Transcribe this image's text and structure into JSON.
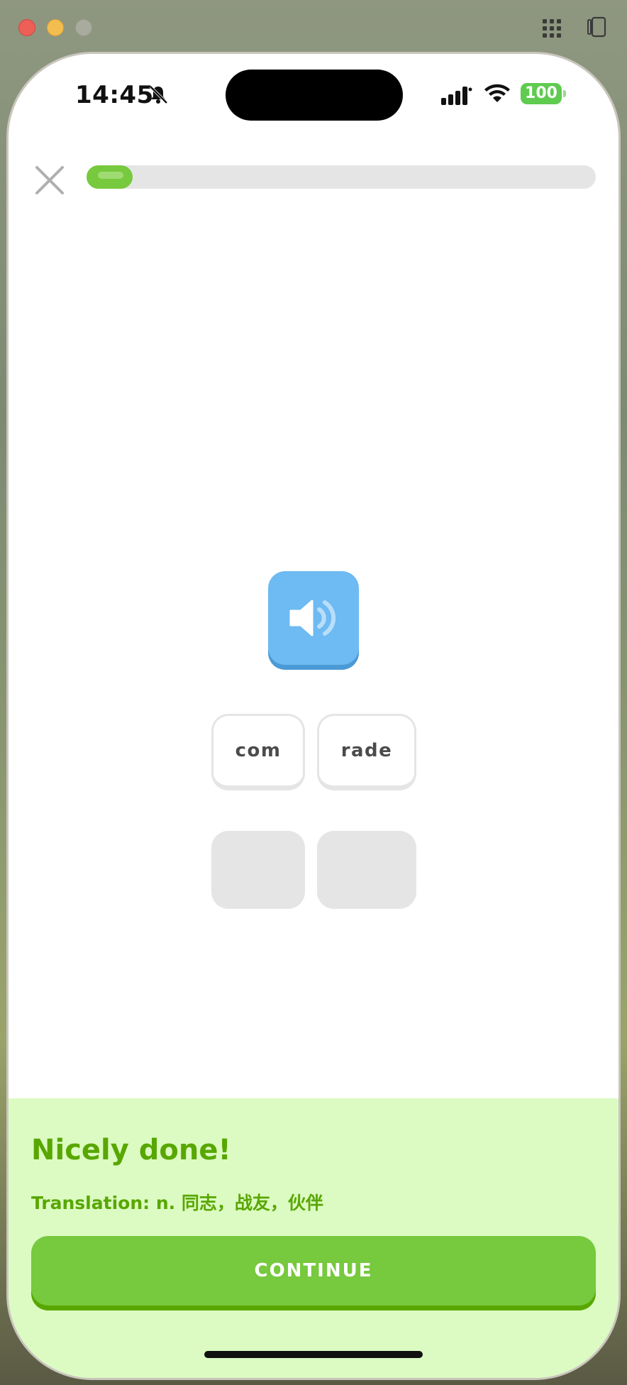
{
  "status_bar": {
    "time": "14:45",
    "battery_level": "100",
    "icons": [
      "bell-slash-icon",
      "cellular-signal-icon",
      "wifi-icon",
      "battery-icon"
    ]
  },
  "lesson": {
    "progress_fraction": 0.09,
    "accent_color": "#77c93d",
    "speaker_color": "#6ebaf2",
    "tiles": [
      {
        "label": "com"
      },
      {
        "label": "rade"
      }
    ],
    "answer_slots": 2
  },
  "feedback": {
    "title": "Nicely done!",
    "translation": "Translation: n. 同志，战友，伙伴",
    "continue_label": "CONTINUE",
    "panel_color": "#dcfbc2"
  }
}
